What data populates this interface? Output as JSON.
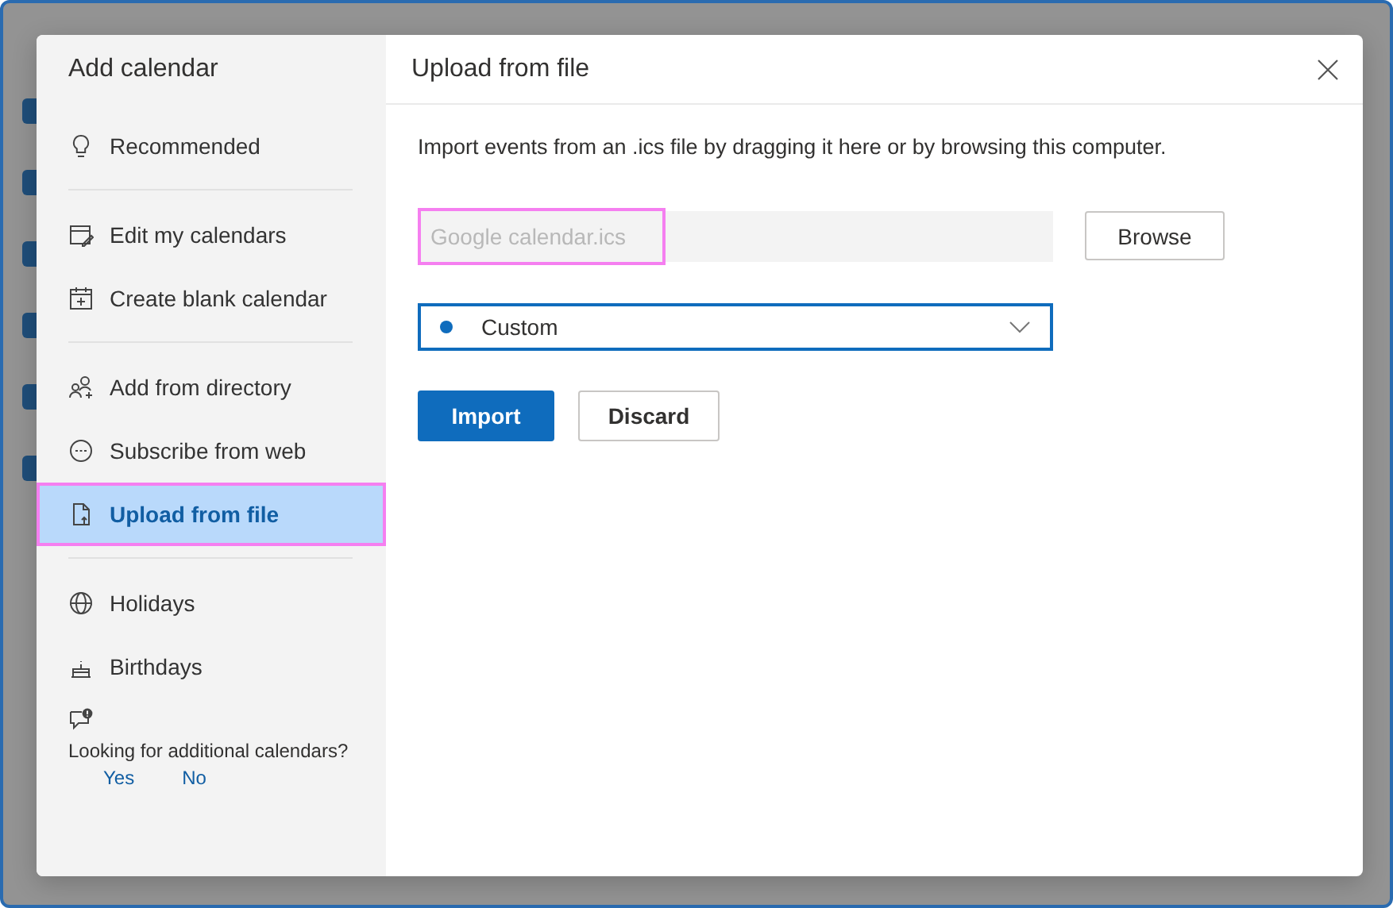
{
  "dialog": {
    "sidebar": {
      "title": "Add calendar",
      "groups": [
        {
          "items": [
            {
              "label": "Recommended",
              "selected": false,
              "highlighted": false
            }
          ]
        },
        {
          "items": [
            {
              "label": "Edit my calendars",
              "selected": false,
              "highlighted": false
            },
            {
              "label": "Create blank calendar",
              "selected": false,
              "highlighted": false
            }
          ]
        },
        {
          "items": [
            {
              "label": "Add from directory",
              "selected": false,
              "highlighted": false
            },
            {
              "label": "Subscribe from web",
              "selected": false,
              "highlighted": false
            },
            {
              "label": "Upload from file",
              "selected": true,
              "highlighted": true
            }
          ]
        },
        {
          "items": [
            {
              "label": "Holidays",
              "selected": false,
              "highlighted": false
            },
            {
              "label": "Birthdays",
              "selected": false,
              "highlighted": false
            }
          ]
        }
      ],
      "feedback": {
        "text": "Looking for additional calendars?",
        "actions": [
          "Yes",
          "No"
        ]
      }
    },
    "main": {
      "title": "Upload from file",
      "description": "Import events from an .ics file by dragging it here or by browsing this computer.",
      "file_field": {
        "placeholder": "Google calendar.ics",
        "highlighted": true
      },
      "browse_button": "Browse",
      "calendar_select": {
        "value": "Custom",
        "color": "#0f6cbd"
      },
      "buttons": [
        {
          "label": "Import",
          "kind": "primary"
        },
        {
          "label": "Discard",
          "kind": "secondary"
        }
      ]
    }
  }
}
